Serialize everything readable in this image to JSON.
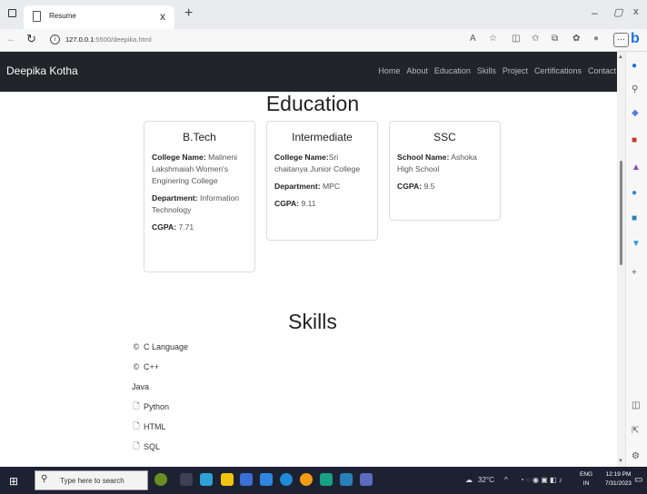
{
  "browser": {
    "tab_title": "Resume",
    "tab_close": "x",
    "new_tab": "+",
    "url_host": "127.0.0.1",
    "url_port_path": ":5500/deepika.html",
    "window_min": "–",
    "window_max": "▢",
    "window_close": "x",
    "more_label": "···",
    "bing_label": "b"
  },
  "navbar": {
    "brand": "Deepika Kotha",
    "links": [
      "Home",
      "About",
      "Education",
      "Skills",
      "Project",
      "Certifications",
      "Contact"
    ]
  },
  "education": {
    "title": "Education",
    "cards": [
      {
        "degree": "B.Tech",
        "lines": [
          {
            "label": "College Name:",
            "value": " Malineni Lakshmaiah Women's Enginering College"
          },
          {
            "label": "Department:",
            "value": " Information Technology"
          },
          {
            "label": "CGPA:",
            "value": " 7.71"
          }
        ]
      },
      {
        "degree": "Intermediate",
        "lines": [
          {
            "label": "College Name:",
            "value": "Sri chaitanya Junior College"
          },
          {
            "label": "Department:",
            "value": " MPC"
          },
          {
            "label": "CGPA:",
            "value": " 9.11"
          }
        ]
      },
      {
        "degree": "SSC",
        "lines": [
          {
            "label": "School Name:",
            "value": " Ashoka High School"
          },
          {
            "label": "CGPA:",
            "value": " 9.5"
          }
        ]
      }
    ]
  },
  "skills": {
    "title": "Skills",
    "items": [
      {
        "icon": "c-icon",
        "glyph": "©",
        "label": "C Language"
      },
      {
        "icon": "c-icon",
        "glyph": "©",
        "label": "C++"
      },
      {
        "icon": "none",
        "glyph": "",
        "label": "Java"
      },
      {
        "icon": "file-icon",
        "glyph": "🗋",
        "label": "Python"
      },
      {
        "icon": "file-icon",
        "glyph": "🗋",
        "label": "HTML"
      },
      {
        "icon": "file-icon",
        "glyph": "🗋",
        "label": "SQL"
      }
    ]
  },
  "taskbar": {
    "search_placeholder": "Type here to search",
    "weather": "32°C",
    "lang_line1": "ENG",
    "lang_line2": "IN",
    "time": "12:19 PM",
    "date": "7/31/2023"
  }
}
